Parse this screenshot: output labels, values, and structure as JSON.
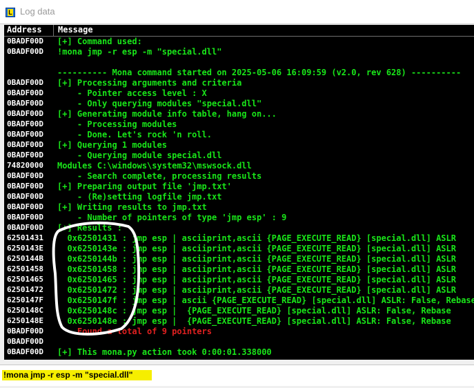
{
  "window": {
    "title": "Log data",
    "app_icon": "L"
  },
  "header": {
    "address": "Address",
    "message": "Message"
  },
  "rows": [
    {
      "address": "0BADF00D",
      "message": "[+] Command used:",
      "color": "#19e619"
    },
    {
      "address": "0BADF00D",
      "message": "!mona jmp -r esp -m \"special.dll\"",
      "color": "#19e619"
    },
    {
      "address": "",
      "message": "",
      "color": "#19e619"
    },
    {
      "address": "",
      "message": "---------- Mona command started on 2025-05-06 16:09:59 (v2.0, rev 628) ----------",
      "color": "#19e619"
    },
    {
      "address": "0BADF00D",
      "message": "[+] Processing arguments and criteria",
      "color": "#19e619"
    },
    {
      "address": "0BADF00D",
      "message": "    - Pointer access level : X",
      "color": "#19e619"
    },
    {
      "address": "0BADF00D",
      "message": "    - Only querying modules \"special.dll\"",
      "color": "#19e619"
    },
    {
      "address": "0BADF00D",
      "message": "[+] Generating module info table, hang on...",
      "color": "#19e619"
    },
    {
      "address": "0BADF00D",
      "message": "    - Processing modules",
      "color": "#19e619"
    },
    {
      "address": "0BADF00D",
      "message": "    - Done. Let's rock 'n roll.",
      "color": "#19e619"
    },
    {
      "address": "0BADF00D",
      "message": "[+] Querying 1 modules",
      "color": "#19e619"
    },
    {
      "address": "0BADF00D",
      "message": "    - Querying module special.dll",
      "color": "#19e619"
    },
    {
      "address": "74820000",
      "message": "Modules C:\\windows\\system32\\mswsock.dll",
      "color": "#19e619"
    },
    {
      "address": "0BADF00D",
      "message": "    - Search complete, processing results",
      "color": "#19e619"
    },
    {
      "address": "0BADF00D",
      "message": "[+] Preparing output file 'jmp.txt'",
      "color": "#19e619"
    },
    {
      "address": "0BADF00D",
      "message": "    - (Re)setting logfile jmp.txt",
      "color": "#19e619"
    },
    {
      "address": "0BADF00D",
      "message": "[+] Writing results to jmp.txt",
      "color": "#19e619"
    },
    {
      "address": "0BADF00D",
      "message": "    - Number of pointers of type 'jmp esp' : 9",
      "color": "#19e619"
    },
    {
      "address": "0BADF00D",
      "message": "[+] Results :",
      "color": "#19e619"
    },
    {
      "address": "62501431",
      "message": "  0x62501431 : jmp esp | asciiprint,ascii {PAGE_EXECUTE_READ} [special.dll] ASLR",
      "color": "#19e619"
    },
    {
      "address": "6250143E",
      "message": "  0x6250143e : jmp esp | asciiprint,ascii {PAGE_EXECUTE_READ} [special.dll] ASLR",
      "color": "#19e619"
    },
    {
      "address": "6250144B",
      "message": "  0x6250144b : jmp esp | asciiprint,ascii {PAGE_EXECUTE_READ} [special.dll] ASLR",
      "color": "#19e619"
    },
    {
      "address": "62501458",
      "message": "  0x62501458 : jmp esp | asciiprint,ascii {PAGE_EXECUTE_READ} [special.dll] ASLR",
      "color": "#19e619"
    },
    {
      "address": "62501465",
      "message": "  0x62501465 : jmp esp | asciiprint,ascii {PAGE_EXECUTE_READ} [special.dll] ASLR",
      "color": "#19e619"
    },
    {
      "address": "62501472",
      "message": "  0x62501472 : jmp esp | asciiprint,ascii {PAGE_EXECUTE_READ} [special.dll] ASLR",
      "color": "#19e619"
    },
    {
      "address": "6250147F",
      "message": "  0x6250147f : jmp esp | ascii {PAGE_EXECUTE_READ} [special.dll] ASLR: False, Rebase",
      "color": "#19e619"
    },
    {
      "address": "6250148C",
      "message": "  0x6250148c : jmp esp |  {PAGE_EXECUTE_READ} [special.dll] ASLR: False, Rebase",
      "color": "#19e619"
    },
    {
      "address": "6250148E",
      "message": "  0x6250148e : jmp esp |  {PAGE_EXECUTE_READ} [special.dll] ASLR: False, Rebase",
      "color": "#19e619"
    },
    {
      "address": "0BADF00D",
      "message": "    Found a total of 9 pointers",
      "color": "#e02020"
    },
    {
      "address": "0BADF00D",
      "message": "",
      "color": "#19e619"
    },
    {
      "address": "0BADF00D",
      "message": "[+] This mona.py action took 0:00:01.338000",
      "color": "#19e619"
    }
  ],
  "command_bar": {
    "value": "!mona jmp -r esp -m \"special.dll\""
  },
  "colors": {
    "log_green": "#19e619",
    "log_red": "#e02020",
    "highlight_yellow": "#f6ee00",
    "annotation": "#ffffff"
  }
}
